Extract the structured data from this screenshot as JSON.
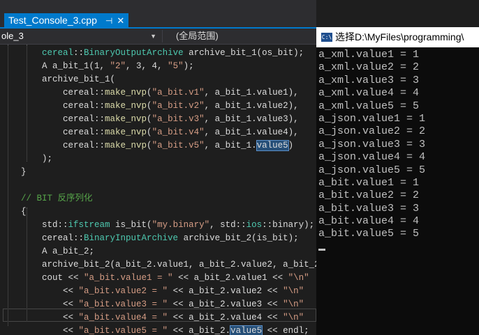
{
  "editor": {
    "tab": {
      "title": "Test_Console_3.cpp",
      "pin_icon": "pin-icon",
      "close_icon": "close-icon"
    },
    "nav": {
      "file": "ole_3",
      "scope": "(全局范围)"
    },
    "lines": [
      [
        {
          "t": "        "
        },
        {
          "t": "cereal",
          "c": "ns"
        },
        {
          "t": "::"
        },
        {
          "t": "BinaryOutputArchive",
          "c": "ns"
        },
        {
          "t": " archive_bit_1(os_bit);"
        }
      ],
      [
        {
          "t": "        A a_bit_1(1, "
        },
        {
          "t": "\"2\"",
          "c": "str"
        },
        {
          "t": ", 3, 4, "
        },
        {
          "t": "\"5\"",
          "c": "str"
        },
        {
          "t": ");"
        }
      ],
      [
        {
          "t": "        archive_bit_1("
        }
      ],
      [
        {
          "t": "            cereal::"
        },
        {
          "t": "make_nvp",
          "c": "fn"
        },
        {
          "t": "("
        },
        {
          "t": "\"a_bit.v1\"",
          "c": "str"
        },
        {
          "t": ", a_bit_1.value1),"
        }
      ],
      [
        {
          "t": "            cereal::"
        },
        {
          "t": "make_nvp",
          "c": "fn"
        },
        {
          "t": "("
        },
        {
          "t": "\"a_bit.v2\"",
          "c": "str"
        },
        {
          "t": ", a_bit_1.value2),"
        }
      ],
      [
        {
          "t": "            cereal::"
        },
        {
          "t": "make_nvp",
          "c": "fn"
        },
        {
          "t": "("
        },
        {
          "t": "\"a_bit.v3\"",
          "c": "str"
        },
        {
          "t": ", a_bit_1.value3),"
        }
      ],
      [
        {
          "t": "            cereal::"
        },
        {
          "t": "make_nvp",
          "c": "fn"
        },
        {
          "t": "("
        },
        {
          "t": "\"a_bit.v4\"",
          "c": "str"
        },
        {
          "t": ", a_bit_1.value4),"
        }
      ],
      [
        {
          "t": "            cereal::"
        },
        {
          "t": "make_nvp",
          "c": "fn"
        },
        {
          "t": "("
        },
        {
          "t": "\"a_bit.v5\"",
          "c": "str"
        },
        {
          "t": ", a_bit_1."
        },
        {
          "t": "value5",
          "c": "hl"
        },
        {
          "t": ")"
        }
      ],
      [
        {
          "t": "        );"
        }
      ],
      [
        {
          "t": "    }"
        }
      ],
      [
        {
          "t": ""
        }
      ],
      [
        {
          "t": "    "
        },
        {
          "t": "// BIT 反序列化",
          "c": "cm"
        }
      ],
      [
        {
          "t": "    {"
        }
      ],
      [
        {
          "t": "        std::"
        },
        {
          "t": "ifstream",
          "c": "ns"
        },
        {
          "t": " is_bit("
        },
        {
          "t": "\"my.binary\"",
          "c": "str"
        },
        {
          "t": ", std::"
        },
        {
          "t": "ios",
          "c": "ns"
        },
        {
          "t": "::binary);"
        }
      ],
      [
        {
          "t": "        cereal::"
        },
        {
          "t": "BinaryInputArchive",
          "c": "ns"
        },
        {
          "t": " archive_bit_2(is_bit);"
        }
      ],
      [
        {
          "t": "        A a_bit_2;"
        }
      ],
      [
        {
          "t": "        archive_bit_2(a_bit_2.value1, a_bit_2.value2, a_bit_2."
        }
      ],
      [
        {
          "t": "        cout << "
        },
        {
          "t": "\"a_bit.value1 = \"",
          "c": "str"
        },
        {
          "t": " << a_bit_2.value1 << "
        },
        {
          "t": "\"\\n\"",
          "c": "str"
        }
      ],
      [
        {
          "t": "            << "
        },
        {
          "t": "\"a_bit.value2 = \"",
          "c": "str"
        },
        {
          "t": " << a_bit_2.value2 << "
        },
        {
          "t": "\"\\n\"",
          "c": "str"
        }
      ],
      [
        {
          "t": "            << "
        },
        {
          "t": "\"a_bit.value3 = \"",
          "c": "str"
        },
        {
          "t": " << a_bit_2.value3 << "
        },
        {
          "t": "\"\\n\"",
          "c": "str"
        }
      ],
      [
        {
          "t": "            << "
        },
        {
          "t": "\"a_bit.value4 = \"",
          "c": "str"
        },
        {
          "t": " << a_bit_2.value4 << "
        },
        {
          "t": "\"\\n\"",
          "c": "str"
        }
      ],
      [
        {
          "t": "            << "
        },
        {
          "t": "\"a_bit.value5 = \"",
          "c": "str"
        },
        {
          "t": " << a_bit_2."
        },
        {
          "t": "value5",
          "c": "hl"
        },
        {
          "t": " << endl;"
        }
      ],
      [
        {
          "t": "    }"
        }
      ]
    ]
  },
  "console": {
    "icon": "console-window-icon",
    "icon_text": "C:\\",
    "title": "选择D:\\MyFiles\\programming\\",
    "output": [
      "a_xml.value1 = 1",
      "a_xml.value2 = 2",
      "a_xml.value3 = 3",
      "a_xml.value4 = 4",
      "a_xml.value5 = 5",
      "a_json.value1 = 1",
      "a_json.value2 = 2",
      "a_json.value3 = 3",
      "a_json.value4 = 4",
      "a_json.value5 = 5",
      "a_bit.value1 = 1",
      "a_bit.value2 = 2",
      "a_bit.value3 = 3",
      "a_bit.value4 = 4",
      "a_bit.value5 = 5"
    ]
  },
  "colors": {
    "accent": "#007acc",
    "editor_bg": "#1e1e1e",
    "console_bg": "#0c0c0c"
  }
}
